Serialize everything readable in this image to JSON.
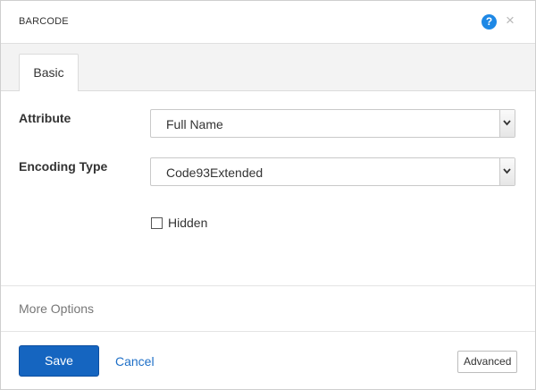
{
  "dialog": {
    "title": "BARCODE",
    "help_icon": "?",
    "close_icon": "×"
  },
  "tabs": [
    {
      "label": "Basic",
      "active": true
    }
  ],
  "form": {
    "attribute": {
      "label": "Attribute",
      "value": "Full Name"
    },
    "encoding_type": {
      "label": "Encoding Type",
      "value": "Code93Extended"
    },
    "hidden": {
      "label": "Hidden",
      "checked": false
    }
  },
  "more_options": "More Options",
  "footer": {
    "save_label": "Save",
    "cancel_label": "Cancel",
    "advanced_label": "Advanced"
  },
  "colors": {
    "primary": "#1565c0",
    "link": "#1e6fc7",
    "help": "#1e88e5",
    "tabbar_bg": "#f3f3f3"
  }
}
